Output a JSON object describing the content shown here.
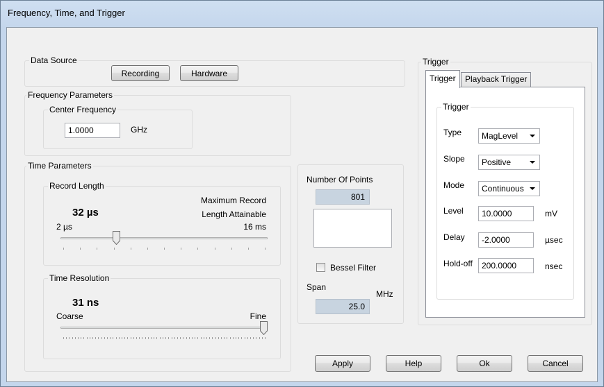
{
  "window": {
    "title": "Frequency, Time, and Trigger"
  },
  "data_source": {
    "legend": "Data Source",
    "recording_label": "Recording",
    "hardware_label": "Hardware"
  },
  "frequency": {
    "legend": "Frequency Parameters",
    "center_legend": "Center Frequency",
    "center_value": "1.0000",
    "center_unit": "GHz"
  },
  "time": {
    "legend": "Time Parameters",
    "record_legend": "Record Length",
    "record_value": "32 µs",
    "max_record_line1": "Maximum Record",
    "max_record_line2": "Length Attainable",
    "record_min": "2 µs",
    "record_max": "16 ms",
    "record_slider_position": 0.26,
    "resolution_legend": "Time Resolution",
    "resolution_value": "31 ns",
    "resolution_min": "Coarse",
    "resolution_max": "Fine",
    "resolution_slider_position": 1.0
  },
  "points": {
    "label": "Number Of Points",
    "value": "801",
    "bessel_label": "Bessel Filter",
    "bessel_checked": false,
    "span_label": "Span",
    "span_unit": "MHz",
    "span_value": "25.0"
  },
  "trigger": {
    "legend": "Trigger",
    "tabs": [
      "Trigger",
      "Playback Trigger"
    ],
    "inner_legend": "Trigger",
    "type_label": "Type",
    "type_value": "MagLevel",
    "slope_label": "Slope",
    "slope_value": "Positive",
    "mode_label": "Mode",
    "mode_value": "Continuous",
    "level_label": "Level",
    "level_value": "10.0000",
    "level_unit": "mV",
    "delay_label": "Delay",
    "delay_value": "-2.0000",
    "delay_unit": "µsec",
    "holdoff_label": "Hold-off",
    "holdoff_value": "200.0000",
    "holdoff_unit": "nsec"
  },
  "buttons": {
    "apply": "Apply",
    "help": "Help",
    "ok": "Ok",
    "cancel": "Cancel"
  }
}
